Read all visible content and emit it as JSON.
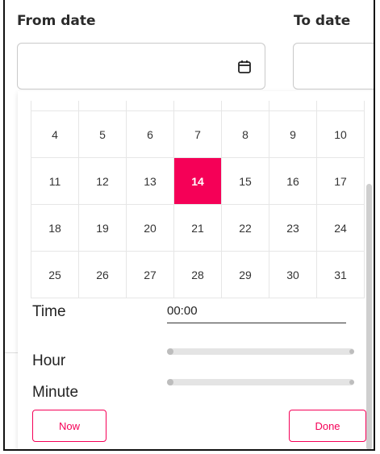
{
  "from_date": {
    "label": "From date",
    "value": "",
    "icon": "calendar-icon"
  },
  "to_date": {
    "label": "To date",
    "value": ""
  },
  "calendar": {
    "weeks": [
      [
        "4",
        "5",
        "6",
        "7",
        "8",
        "9",
        "10"
      ],
      [
        "11",
        "12",
        "13",
        "14",
        "15",
        "16",
        "17"
      ],
      [
        "18",
        "19",
        "20",
        "21",
        "22",
        "23",
        "24"
      ],
      [
        "25",
        "26",
        "27",
        "28",
        "29",
        "30",
        "31"
      ]
    ],
    "selected_day": "14",
    "selected_color": "#f50057"
  },
  "time": {
    "label": "Time",
    "value": "00:00"
  },
  "hour": {
    "label": "Hour",
    "value": 0
  },
  "minute": {
    "label": "Minute",
    "value": 0
  },
  "buttons": {
    "now": "Now",
    "done": "Done"
  },
  "colors": {
    "accent": "#f50057"
  }
}
